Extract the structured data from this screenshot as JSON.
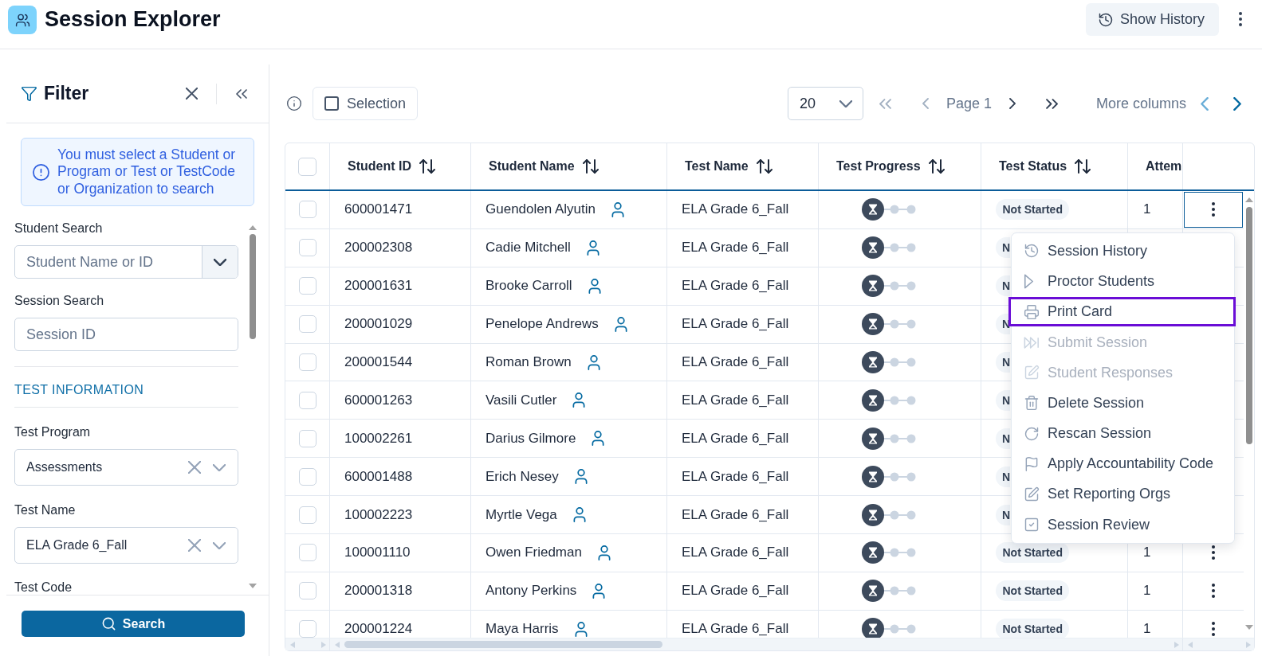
{
  "header": {
    "title": "Session Explorer",
    "history_button": "Show History"
  },
  "filter": {
    "title": "Filter",
    "alert": "You must select a Student or Program or Test or TestCode or Organization to search",
    "fields": [
      {
        "kind": "combo",
        "label": "Student Search",
        "placeholder": "Student Name or ID"
      },
      {
        "kind": "text",
        "label": "Session Search",
        "placeholder": "Session ID"
      },
      {
        "kind": "section",
        "label": "TEST INFORMATION"
      },
      {
        "kind": "select",
        "label": "Test Program",
        "value": "Assessments"
      },
      {
        "kind": "select",
        "label": "Test Name",
        "value": "ELA Grade 6_Fall"
      },
      {
        "kind": "label",
        "label": "Test Code"
      }
    ],
    "search_button": "Search"
  },
  "toolbar": {
    "selection": {
      "label": "Selection",
      "checked": false
    },
    "page_size": "20",
    "first": {
      "disabled": true
    },
    "previous": {
      "disabled": true
    },
    "page": "Page 1",
    "next": {
      "disabled": false
    },
    "last": {
      "disabled": false
    },
    "more_columns": {
      "label": "More columns",
      "previous": {
        "disabled": true
      },
      "next": {
        "disabled": false
      }
    }
  },
  "table": {
    "select_all": {
      "checked": false
    },
    "columns": [
      {
        "label": "Student ID",
        "kind": "sortable"
      },
      {
        "label": "Student Name",
        "kind": "sortable"
      },
      {
        "label": "Test Name",
        "kind": "sortable"
      },
      {
        "label": "Test Progress",
        "kind": "sortable"
      },
      {
        "label": "Test Status",
        "kind": "sortable"
      },
      {
        "label": "Attem",
        "kind": "plain"
      }
    ],
    "rows": [
      {
        "checked": false,
        "student_id": "600001471",
        "student_name": "Guendolen Alyutin",
        "test_name": "ELA Grade 6_Fall",
        "status": "Not Started",
        "attempts": "1",
        "active": true
      },
      {
        "checked": false,
        "student_id": "200002308",
        "student_name": "Cadie Mitchell",
        "test_name": "ELA Grade 6_Fall",
        "status": "N",
        "active": false
      },
      {
        "checked": false,
        "student_id": "200001631",
        "student_name": "Brooke Carroll",
        "test_name": "ELA Grade 6_Fall",
        "status": "N",
        "active": false
      },
      {
        "checked": false,
        "student_id": "200001029",
        "student_name": "Penelope Andrews",
        "test_name": "ELA Grade 6_Fall",
        "status": "N",
        "active": false
      },
      {
        "checked": false,
        "student_id": "200001544",
        "student_name": "Roman Brown",
        "test_name": "ELA Grade 6_Fall",
        "status": "N",
        "active": false
      },
      {
        "checked": false,
        "student_id": "600001263",
        "student_name": "Vasili Cutler",
        "test_name": "ELA Grade 6_Fall",
        "status": "N",
        "active": false
      },
      {
        "checked": false,
        "student_id": "100002261",
        "student_name": "Darius Gilmore",
        "test_name": "ELA Grade 6_Fall",
        "status": "N",
        "active": false
      },
      {
        "checked": false,
        "student_id": "600001488",
        "student_name": "Erich Nesey",
        "test_name": "ELA Grade 6_Fall",
        "status": "N",
        "active": false
      },
      {
        "checked": false,
        "student_id": "100002223",
        "student_name": "Myrtle Vega",
        "test_name": "ELA Grade 6_Fall",
        "status": "N",
        "active": false
      },
      {
        "checked": false,
        "student_id": "100001110",
        "student_name": "Owen Friedman",
        "test_name": "ELA Grade 6_Fall",
        "status": "Not Started",
        "attempts": "1",
        "active": false
      },
      {
        "checked": false,
        "student_id": "200001318",
        "student_name": "Antony Perkins",
        "test_name": "ELA Grade 6_Fall",
        "status": "Not Started",
        "attempts": "1",
        "active": false
      },
      {
        "checked": false,
        "student_id": "200001224",
        "student_name": "Maya Harris",
        "test_name": "ELA Grade 6_Fall",
        "status": "Not Started",
        "attempts": "1",
        "active": false
      }
    ]
  },
  "row_menu": {
    "items": [
      {
        "label": "Session History",
        "disabled": false,
        "selected": false
      },
      {
        "label": "Proctor Students",
        "disabled": false,
        "selected": false
      },
      {
        "label": "Print Card",
        "disabled": false,
        "selected": true
      },
      {
        "label": "Submit Session",
        "disabled": true,
        "selected": false
      },
      {
        "label": "Student Responses",
        "disabled": true,
        "selected": false
      },
      {
        "label": "Delete Session",
        "disabled": false,
        "selected": false
      },
      {
        "label": "Rescan Session",
        "disabled": false,
        "selected": false
      },
      {
        "label": "Apply Accountability Code",
        "disabled": false,
        "selected": false
      },
      {
        "label": "Set Reporting Orgs",
        "disabled": false,
        "selected": false
      },
      {
        "label": "Session Review",
        "disabled": false,
        "selected": false
      }
    ]
  }
}
